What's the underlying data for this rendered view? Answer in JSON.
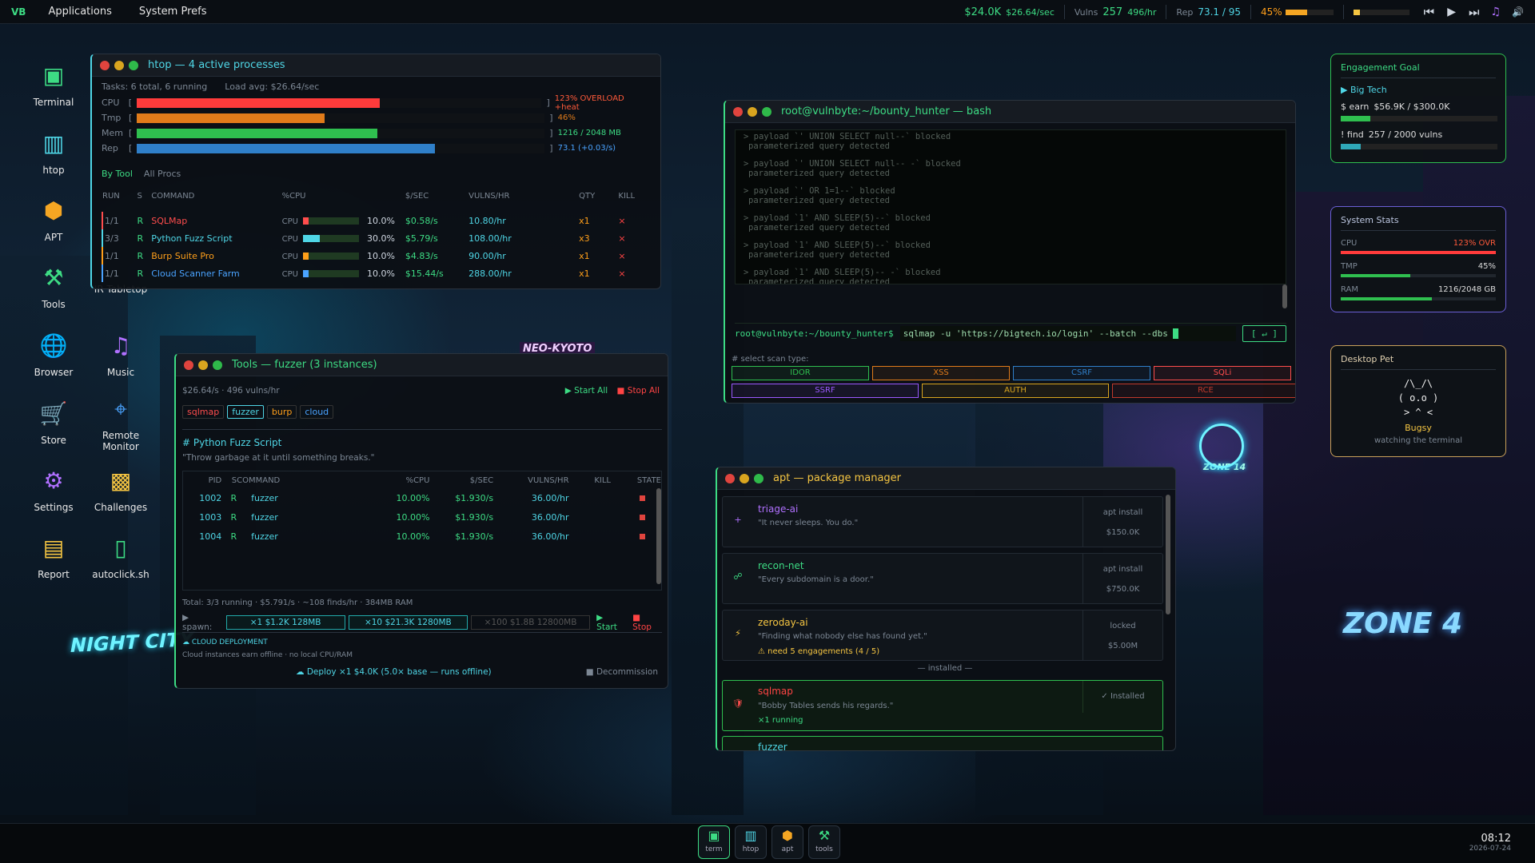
{
  "topbar": {
    "logo": "VB",
    "menu": [
      "Applications",
      "System Prefs"
    ],
    "money": "$24.0K",
    "money_rate": "$26.64/sec",
    "vulns_label": "Vulns",
    "vulns": "257",
    "vulns_rate": "496/hr",
    "rep_label": "Rep",
    "rep": "73.1 / 95",
    "heat": "45%",
    "heat_fraction": 0.45,
    "media": [
      "⏮",
      "▶",
      "⏭",
      "♫",
      "🔊"
    ]
  },
  "desktop_icons": [
    {
      "label": "Terminal",
      "icon": "terminal-icon"
    },
    {
      "label": "htop",
      "icon": "chart-icon"
    },
    {
      "label": "APT",
      "icon": "package-icon"
    },
    {
      "label": "Tools",
      "icon": "wrench-icon"
    },
    {
      "label": "Browser",
      "icon": "globe-icon"
    },
    {
      "label": "Store",
      "icon": "cart-icon"
    },
    {
      "label": "Settings",
      "icon": "gear-icon"
    },
    {
      "label": "Report",
      "icon": "document-icon"
    }
  ],
  "desktop_icons2": [
    {
      "label": "IR Tabletop",
      "icon": "table-icon"
    },
    {
      "label": "Music",
      "icon": "music-icon"
    },
    {
      "label": "Remote Monitor",
      "icon": "satellite-icon"
    },
    {
      "label": "Challenges",
      "icon": "checker-icon"
    },
    {
      "label": "autoclick.sh",
      "icon": "mouse-icon"
    }
  ],
  "htop": {
    "title": "htop — 4 active processes",
    "summary": "Tasks: 6 total, 6 running",
    "load": "Load avg: $26.64/sec",
    "meters": [
      {
        "label": "CPU",
        "value": "123% OVERLOAD +heat",
        "fill": 0.6,
        "color": "#ff3b3b"
      },
      {
        "label": "Tmp",
        "value": "46%",
        "fill": 0.46,
        "color": "#e07b1a"
      },
      {
        "label": "Mem",
        "value": "1216 / 2048 MB",
        "fill": 0.59,
        "color": "#2fbf4f"
      },
      {
        "label": "Rep",
        "value": "73.1 (+0.03/s)",
        "fill": 0.73,
        "color": "#2f7fc9"
      }
    ],
    "tabs": [
      "By Tool",
      "All Procs"
    ],
    "headers": [
      "RUN",
      "S",
      "COMMAND",
      "%CPU",
      "$/SEC",
      "VULNS/HR",
      "QTY",
      "KILL"
    ],
    "rows": [
      {
        "run": "1/1",
        "s": "R",
        "cmd": "SQLMap",
        "cpu_label": "CPU",
        "cpu": "10.0%",
        "cpu_fill": 0.1,
        "sec": "$0.58/s",
        "vph": "10.80/hr",
        "qty": "x1",
        "color": "#ff4d4d"
      },
      {
        "run": "3/3",
        "s": "R",
        "cmd": "Python Fuzz Script",
        "cpu_label": "CPU",
        "cpu": "30.0%",
        "cpu_fill": 0.3,
        "sec": "$5.79/s",
        "vph": "108.00/hr",
        "qty": "x3",
        "color": "#4fd6e6"
      },
      {
        "run": "1/1",
        "s": "R",
        "cmd": "Burp Suite Pro",
        "cpu_label": "CPU",
        "cpu": "10.0%",
        "cpu_fill": 0.1,
        "sec": "$4.83/s",
        "vph": "90.00/hr",
        "qty": "x1",
        "color": "#ff9f1a"
      },
      {
        "run": "1/1",
        "s": "R",
        "cmd": "Cloud Scanner Farm",
        "cpu_label": "CPU",
        "cpu": "10.0%",
        "cpu_fill": 0.1,
        "sec": "$15.44/s",
        "vph": "288.00/hr",
        "qty": "x1",
        "color": "#4aa3ff"
      }
    ],
    "kill": "×"
  },
  "bash": {
    "title": "root@vulnbyte:~/bounty_hunter — bash",
    "log": [
      [
        "> payload `' UNION SELECT null--` blocked",
        "parameterized query detected"
      ],
      [
        "> payload `' UNION SELECT null-- -` blocked",
        "parameterized query detected"
      ],
      [
        "> payload `' OR 1=1--` blocked",
        "parameterized query detected"
      ],
      [
        "> payload `1' AND SLEEP(5)--` blocked",
        "parameterized query detected"
      ],
      [
        "> payload `1' AND SLEEP(5)--` blocked",
        "parameterized query detected"
      ],
      [
        "> payload `1' AND SLEEP(5)-- -` blocked",
        "parameterized query detected"
      ]
    ],
    "prompt": "root@vulnbyte:~/bounty_hunter$",
    "command": "sqlmap -u 'https://bigtech.io/login' --batch --dbs",
    "run": "[ ↵ ]",
    "scan_label": "# select scan type:",
    "scans": [
      {
        "label": "IDOR",
        "color": "#2fbf4f"
      },
      {
        "label": "XSS",
        "color": "#e07b1a"
      },
      {
        "label": "CSRF",
        "color": "#2f7fc9"
      },
      {
        "label": "SQLi",
        "color": "#ff4d4d"
      },
      {
        "label": "SSRF",
        "color": "#9b59ff"
      },
      {
        "label": "AUTH",
        "color": "#d9a51f"
      },
      {
        "label": "RCE",
        "color": "#c0392b"
      }
    ]
  },
  "tools": {
    "title": "Tools — fuzzer (3 instances)",
    "rate": "$26.64/s · 496 vulns/hr",
    "start_all": "▶ Start All",
    "stop_all": "■ Stop All",
    "tabs": [
      {
        "label": "sqlmap",
        "color": "#ff4d4d"
      },
      {
        "label": "fuzzer",
        "color": "#4fd6e6"
      },
      {
        "label": "burp",
        "color": "#ff9f1a"
      },
      {
        "label": "cloud",
        "color": "#4aa3ff"
      }
    ],
    "heading": "# Python Fuzz Script",
    "quote": "\"Throw garbage at it until something breaks.\"",
    "headers": [
      "PID",
      "S",
      "COMMAND",
      "%CPU",
      "$/SEC",
      "VULNS/HR",
      "KILL",
      "STATE"
    ],
    "rows": [
      {
        "pid": "1002",
        "s": "R",
        "cmd": "fuzzer",
        "cpu": "10.00%",
        "sec": "$1.930/s",
        "vph": "36.00/hr"
      },
      {
        "pid": "1003",
        "s": "R",
        "cmd": "fuzzer",
        "cpu": "10.00%",
        "sec": "$1.930/s",
        "vph": "36.00/hr"
      },
      {
        "pid": "1004",
        "s": "R",
        "cmd": "fuzzer",
        "cpu": "10.00%",
        "sec": "$1.930/s",
        "vph": "36.00/hr"
      }
    ],
    "total": "Total: 3/3 running · $5.791/s · ~108 finds/hr · 384MB RAM",
    "spawn": "▶ spawn:",
    "spawn_opts": [
      "×1  $1.2K  128MB",
      "×10  $21.3K  1280MB",
      "×100  $1.8B  12800MB"
    ],
    "start": "▶ Start",
    "stop": "■ Stop",
    "cloud_title": "☁ CLOUD DEPLOYMENT",
    "cloud_note": "Cloud instances earn offline · no local CPU/RAM",
    "deploy": "☁ Deploy ×1  $4.0K  (5.0× base — runs offline)",
    "decommission": "■ Decommission"
  },
  "apt": {
    "title": "apt — package manager",
    "packages": [
      {
        "name": "triage-ai",
        "quote": "\"It never sleeps. You do.\"",
        "action": "apt install",
        "price": "$150.0K",
        "color": "#b070ff",
        "icon": "+"
      },
      {
        "name": "recon-net",
        "quote": "\"Every subdomain is a door.\"",
        "action": "apt install",
        "price": "$750.0K",
        "color": "#3ddc84",
        "icon": "☍"
      },
      {
        "name": "zeroday-ai",
        "quote": "\"Finding what nobody else has found yet.\"",
        "action": "locked",
        "price": "$5.00M",
        "color": "#f5c542",
        "icon": "⚡",
        "warn": "⚠ need 5 engagements  (4 / 5)"
      }
    ],
    "installed_label": "— installed —",
    "installed": [
      {
        "name": "sqlmap",
        "quote": "\"Bobby Tables sends his regards.\"",
        "status": "✓ Installed",
        "running": "×1 running"
      },
      {
        "name": "fuzzer"
      }
    ]
  },
  "widgets": {
    "goal": {
      "title": "Engagement Goal",
      "target": "▶ Big Tech",
      "earn_label": "$ earn",
      "earn": "$56.9K / $300.0K",
      "earn_fill": 0.19,
      "find_label": "! find",
      "find": "257 / 2000 vulns",
      "find_fill": 0.13
    },
    "stats": {
      "title": "System Stats",
      "rows": [
        {
          "label": "CPU",
          "value": "123%  OVR",
          "fill": 1.0,
          "color": "#ff3b3b"
        },
        {
          "label": "TMP",
          "value": "45%",
          "fill": 0.45,
          "color": "#2fbf4f"
        },
        {
          "label": "RAM",
          "value": "1216/2048 GB",
          "fill": 0.59,
          "color": "#2fbf4f"
        }
      ]
    },
    "pet": {
      "title": "Desktop Pet",
      "art": [
        "/\\_/\\",
        "( o.o )",
        "> ^ <"
      ],
      "name": "Bugsy",
      "status": "watching the terminal"
    }
  },
  "dock": [
    {
      "label": "term",
      "icon": "terminal-icon"
    },
    {
      "label": "htop",
      "icon": "chart-icon"
    },
    {
      "label": "apt",
      "icon": "package-icon"
    },
    {
      "label": "tools",
      "icon": "wrench-icon"
    }
  ],
  "clock": {
    "time": "08:12",
    "date": "2026-07-24"
  },
  "wallpaper": {
    "signs": [
      "NIGHT CITY",
      "NEO-KYOTO",
      "ZONE 4",
      "ZONE 14"
    ]
  }
}
